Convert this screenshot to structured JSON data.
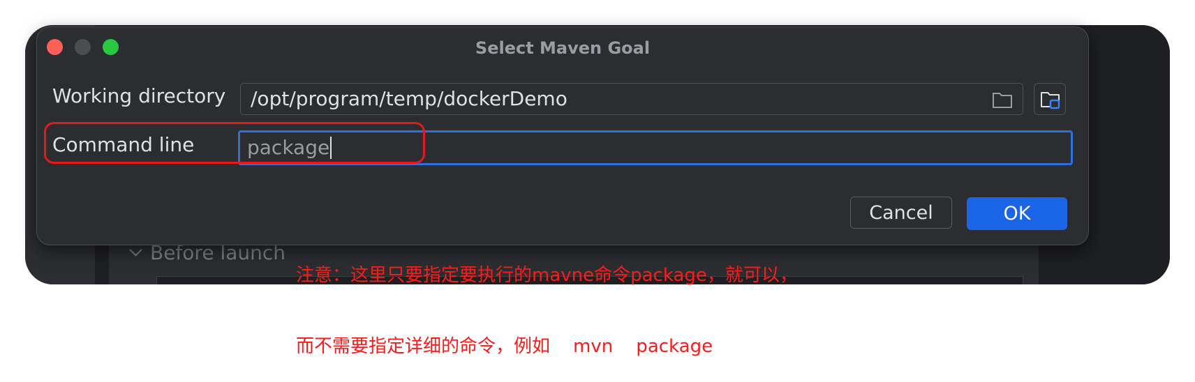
{
  "background_ide": {
    "section_label": "Before launch"
  },
  "dialog": {
    "title": "Select Maven Goal",
    "working_directory": {
      "label": "Working directory",
      "value": "/opt/program/temp/dockerDemo"
    },
    "command_line": {
      "label": "Command line",
      "value": "package"
    },
    "buttons": {
      "cancel": "Cancel",
      "ok": "OK"
    }
  },
  "annotation": {
    "line1": "注意：这里只要指定要执行的mavne命令package，就可以，",
    "line2": "而不需要指定详细的命令，例如    mvn    package",
    "color": "#ff1a1a"
  },
  "colors": {
    "accent": "#1a64e8",
    "focus_border": "#2f6fe0",
    "highlight": "#e11b1b"
  },
  "icons": [
    "folder-icon",
    "browse-folder-icon",
    "chevron-down-icon"
  ]
}
